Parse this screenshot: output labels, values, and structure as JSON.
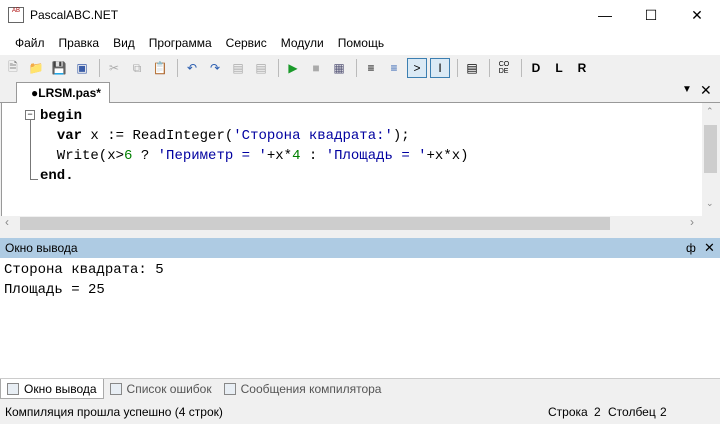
{
  "window": {
    "title": "PascalABC.NET",
    "icon_text": "AB"
  },
  "menu": [
    "Файл",
    "Правка",
    "Вид",
    "Программа",
    "Сервис",
    "Модули",
    "Помощь"
  ],
  "editor": {
    "tab_label": "●LRSM.pas*",
    "lines": [
      [
        {
          "t": "begin",
          "c": "kw"
        }
      ],
      [
        {
          "t": "  "
        },
        {
          "t": "var",
          "c": "kw"
        },
        {
          "t": " x := ReadInteger("
        },
        {
          "t": "'Сторона квадрата:'",
          "c": "str"
        },
        {
          "t": ");"
        }
      ],
      [
        {
          "t": "  Write(x>"
        },
        {
          "t": "6",
          "c": "num"
        },
        {
          "t": " ? "
        },
        {
          "t": "'Периметр = '",
          "c": "str"
        },
        {
          "t": "+x*"
        },
        {
          "t": "4",
          "c": "num"
        },
        {
          "t": " : "
        },
        {
          "t": "'Площадь = '",
          "c": "str"
        },
        {
          "t": "+x*x)"
        }
      ],
      [
        {
          "t": "end.",
          "c": "kw"
        }
      ]
    ]
  },
  "output": {
    "title": "Окно вывода",
    "lines": [
      "Сторона квадрата: 5",
      "Площадь = 25"
    ]
  },
  "bottom_tabs": [
    "Окно вывода",
    "Список ошибок",
    "Сообщения компилятора"
  ],
  "status": {
    "message": "Компиляция прошла успешно (4 строк)",
    "row_label": "Строка",
    "row": "2",
    "col_label": "Столбец",
    "col": "2"
  }
}
